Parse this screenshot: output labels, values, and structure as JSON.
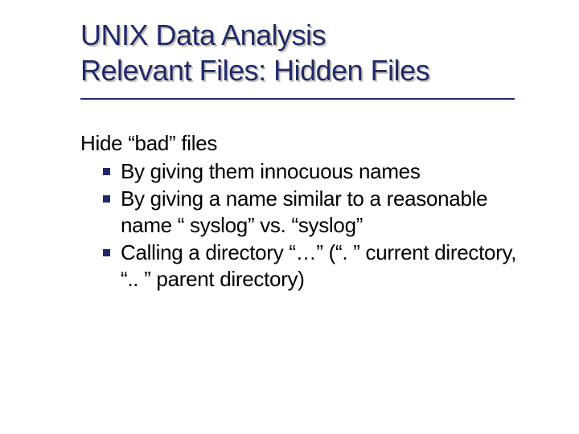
{
  "slide": {
    "title_line1": "UNIX Data Analysis",
    "title_line2": "Relevant Files: Hidden Files",
    "intro": "Hide “bad” files",
    "bullets": [
      "By giving them innocuous names",
      "By giving a name similar to a reasonable name “ syslog” vs. “syslog”",
      "Calling a directory “…” (“. ” current directory, “.. ” parent directory)"
    ],
    "colors": {
      "title": "#1f2a6b",
      "bullet": "#1f2a6b",
      "shadow": "#c9c2b2"
    }
  }
}
